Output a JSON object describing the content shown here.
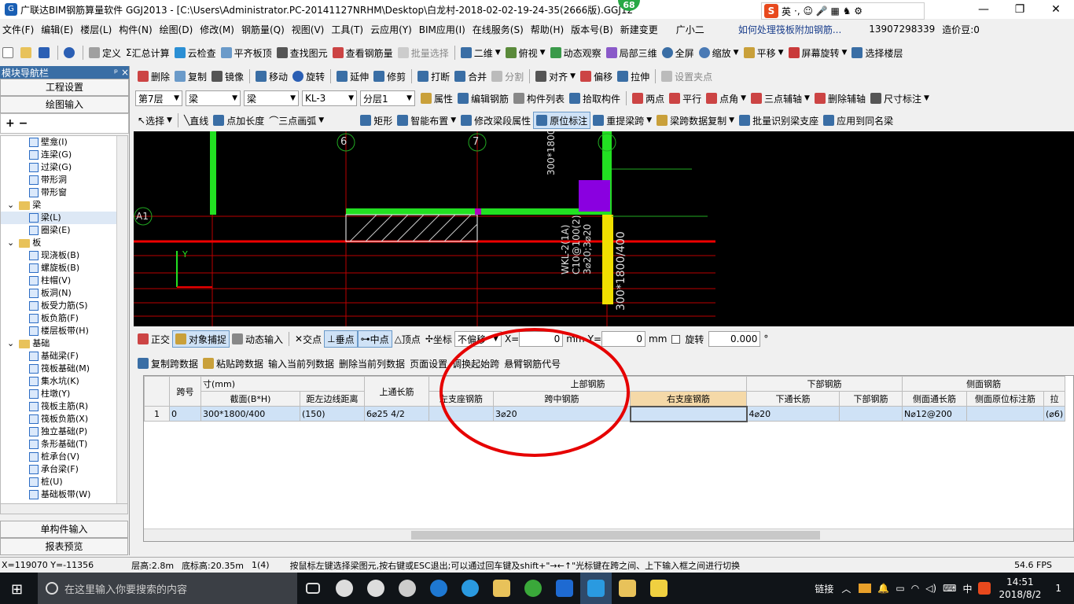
{
  "window": {
    "title": "广联达BIM钢筋算量软件 GGJ2013 - [C:\\Users\\Administrator.PC-20141127NRHM\\Desktop\\白龙村-2018-02-02-19-24-35(2666版).GGJ12",
    "badge": "68",
    "controls": {
      "minimize": "—",
      "restore": "❐",
      "close": "✕"
    }
  },
  "ime": {
    "logo": "S",
    "mode": "英",
    "glyphs": "·, ☺ 🎤 ▦ ♞ ⚙"
  },
  "menu": {
    "items": [
      "文件(F)",
      "编辑(E)",
      "楼层(L)",
      "构件(N)",
      "绘图(D)",
      "修改(M)",
      "钢筋量(Q)",
      "视图(V)",
      "工具(T)",
      "云应用(Y)",
      "BIM应用(I)",
      "在线服务(S)",
      "帮助(H)",
      "版本号(B)",
      "新建变更",
      "广小二"
    ],
    "question": "如何处理筏板附加钢筋...",
    "phone": "13907298339",
    "cost": "造价豆:0"
  },
  "toolbar1": [
    "定义",
    "汇总计算",
    "云检查",
    "平齐板顶",
    "查找图元",
    "查看钢筋量",
    "批量选择",
    "二维",
    "俯视",
    "动态观察",
    "局部三维",
    "全屏",
    "缩放",
    "平移",
    "屏幕旋转",
    "选择楼层"
  ],
  "toolbar2": [
    "删除",
    "复制",
    "镜像",
    "移动",
    "旋转",
    "延伸",
    "修剪",
    "打断",
    "合并",
    "分割",
    "对齐",
    "偏移",
    "拉伸",
    "设置夹点"
  ],
  "toolbar3": {
    "floor": "第7层",
    "type1": "梁",
    "type2": "梁",
    "member": "KL-3",
    "layer": "分层1",
    "buttons": [
      "属性",
      "编辑钢筋",
      "构件列表",
      "拾取构件",
      "两点",
      "平行",
      "点角",
      "三点辅轴",
      "删除辅轴",
      "尺寸标注"
    ]
  },
  "toolbar4": [
    "选择",
    "直线",
    "点加长度",
    "三点画弧",
    "矩形",
    "智能布置",
    "修改梁段属性",
    "原位标注",
    "重提梁跨",
    "梁跨数据复制",
    "批量识别梁支座",
    "应用到同名梁"
  ],
  "leftpanel": {
    "title": "模块导航栏",
    "pin": "ᵖ ×",
    "btn_project": "工程设置",
    "btn_draw": "绘图输入",
    "btn_single": "单构件输入",
    "btn_report": "报表预览",
    "tree": [
      {
        "label": "壁龛(I)",
        "level": 2
      },
      {
        "label": "连梁(G)",
        "level": 2
      },
      {
        "label": "过梁(G)",
        "level": 2
      },
      {
        "label": "带形洞",
        "level": 2
      },
      {
        "label": "带形窗",
        "level": 2
      },
      {
        "label": "梁",
        "level": 1
      },
      {
        "label": "梁(L)",
        "level": 2
      },
      {
        "label": "圈梁(E)",
        "level": 2
      },
      {
        "label": "板",
        "level": 1
      },
      {
        "label": "现浇板(B)",
        "level": 2
      },
      {
        "label": "螺旋板(B)",
        "level": 2
      },
      {
        "label": "柱帽(V)",
        "level": 2
      },
      {
        "label": "板洞(N)",
        "level": 2
      },
      {
        "label": "板受力筋(S)",
        "level": 2
      },
      {
        "label": "板负筋(F)",
        "level": 2
      },
      {
        "label": "楼层板带(H)",
        "level": 2
      },
      {
        "label": "基础",
        "level": 1
      },
      {
        "label": "基础梁(F)",
        "level": 2
      },
      {
        "label": "筏板基础(M)",
        "level": 2
      },
      {
        "label": "集水坑(K)",
        "level": 2
      },
      {
        "label": "柱墩(Y)",
        "level": 2
      },
      {
        "label": "筏板主筋(R)",
        "level": 2
      },
      {
        "label": "筏板负筋(X)",
        "level": 2
      },
      {
        "label": "独立基础(P)",
        "level": 2
      },
      {
        "label": "条形基础(T)",
        "level": 2
      },
      {
        "label": "桩承台(V)",
        "level": 2
      },
      {
        "label": "承台梁(F)",
        "level": 2
      },
      {
        "label": "桩(U)",
        "level": 2
      },
      {
        "label": "基础板带(W)",
        "level": 2
      }
    ]
  },
  "canvas": {
    "axes": [
      "6",
      "7",
      "A1"
    ],
    "texts": [
      "300*1800",
      "300*1800/400",
      "WKL-2(1A)",
      "C10@100(2)",
      "3⌀20;3⌀20",
      "Y"
    ]
  },
  "snapbar": {
    "items": [
      "正交",
      "对象捕捉",
      "动态输入",
      "交点",
      "垂点",
      "中点",
      "顶点",
      "坐标"
    ],
    "offset": "不偏移",
    "x_label": "X=",
    "x_value": "0",
    "y_label": "Y=",
    "y_value": "0",
    "unit": "mm",
    "rotate_label": "旋转",
    "rotate_value": "0.000",
    "deg": "°"
  },
  "gridtoolbar": [
    "复制跨数据",
    "粘贴跨数据",
    "输入当前列数据",
    "删除当前列数据",
    "页面设置",
    "调换起始跨",
    "悬臂钢筋代号"
  ],
  "table": {
    "group_headers": {
      "size": "寸(mm)",
      "top": "上部钢筋",
      "bottom": "下部钢筋",
      "side": "侧面钢筋"
    },
    "headers": [
      "跨号",
      "截面(B*H)",
      "距左边线距离",
      "上通长筋",
      "左支座钢筋",
      "跨中钢筋",
      "右支座钢筋",
      "下通长筋",
      "下部钢筋",
      "侧面通长筋",
      "侧面原位标注筋",
      "拉"
    ],
    "rows": [
      {
        "idx": "1",
        "span": "0",
        "section": "300*1800/400",
        "dist": "(150)",
        "top_through": "6⌀25 4/2",
        "left_support": "",
        "mid": "3⌀20",
        "right_support": "",
        "bottom_through": "4⌀20",
        "bottom": "",
        "side_through": "N⌀12@200",
        "side_inplace": "",
        "tie": "(⌀6)"
      }
    ]
  },
  "status": {
    "coords": "X=119070 Y=-11356",
    "floor_height": "层高:2.8m",
    "base_height": "底标高:20.35m",
    "count": "1(4)",
    "hint": "按鼠标左键选择梁图元,按右键或ESC退出;可以通过回车键及shift+\"→←↑\"光标键在跨之间、上下输入框之间进行切换",
    "fps": "54.6 FPS"
  },
  "taskbar": {
    "search_placeholder": "在这里输入你要搜索的内容",
    "tray_link": "链接",
    "ime": "中",
    "time": "14:51",
    "date": "2018/8/2",
    "notif": "1"
  },
  "colors": {
    "accent": "#3a6ea5",
    "selection": "#cfe2f6",
    "canvas": "#000000",
    "highlight_circle": "#e60000"
  }
}
